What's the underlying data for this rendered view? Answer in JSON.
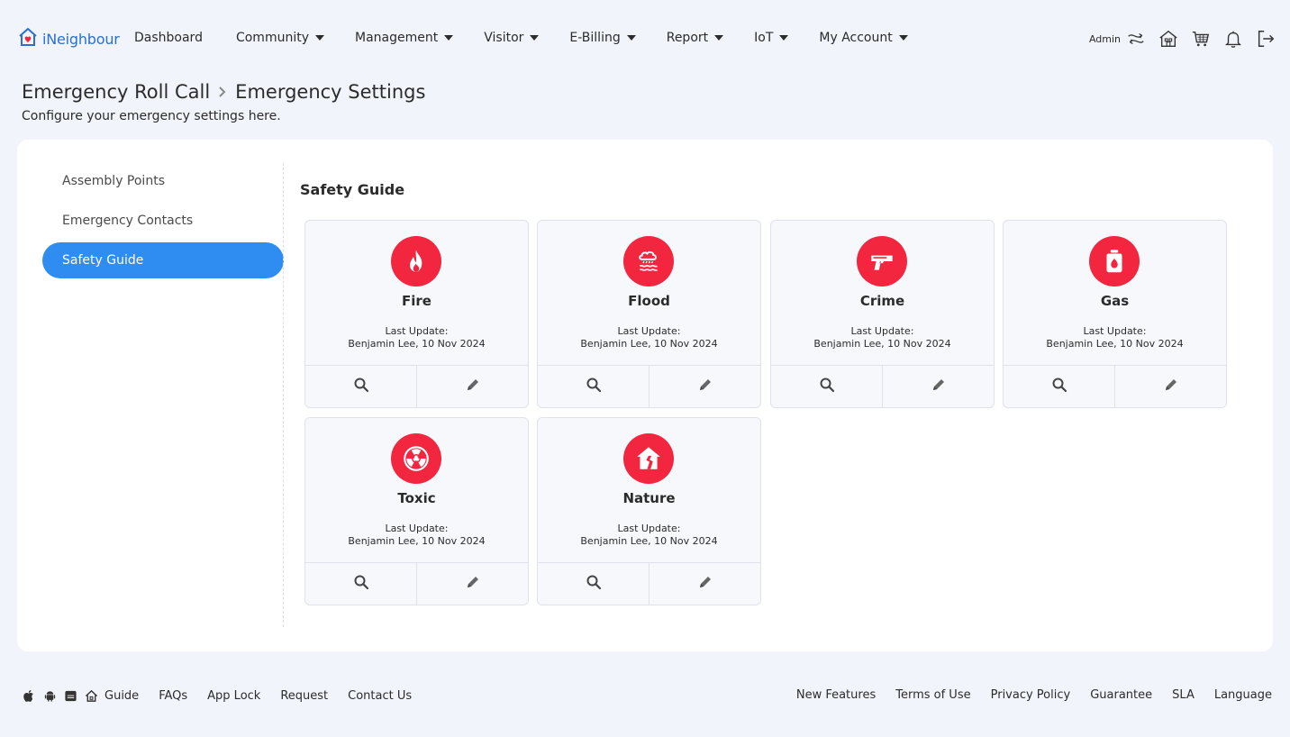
{
  "brand": {
    "name": "iNeighbour",
    "color": "#2a6fd6"
  },
  "nav": {
    "items": [
      {
        "label": "Dashboard",
        "dropdown": false
      },
      {
        "label": "Community",
        "dropdown": true
      },
      {
        "label": "Management",
        "dropdown": true
      },
      {
        "label": "Visitor",
        "dropdown": true
      },
      {
        "label": "E-Billing",
        "dropdown": true
      },
      {
        "label": "Report",
        "dropdown": true
      },
      {
        "label": "IoT",
        "dropdown": true
      },
      {
        "label": "My Account",
        "dropdown": true
      }
    ],
    "user_label": "Admin",
    "right_icons": [
      "switch-icon",
      "property-icon",
      "cart-icon",
      "bell-icon",
      "logout-icon"
    ]
  },
  "header": {
    "breadcrumb_parent": "Emergency Roll Call",
    "breadcrumb_current": "Emergency Settings",
    "subtitle": "Configure your emergency settings here."
  },
  "sidebar": {
    "items": [
      {
        "label": "Assembly Points",
        "active": false
      },
      {
        "label": "Emergency Contacts",
        "active": false
      },
      {
        "label": "Safety Guide",
        "active": true
      }
    ],
    "active_color": "#2f8cf0"
  },
  "section_title": "Safety Guide",
  "accent_red": "#f2263e",
  "guides": [
    {
      "name": "Fire",
      "icon": "fire-icon",
      "last_update_label": "Last Update:",
      "meta": "Benjamin Lee, 10 Nov 2024"
    },
    {
      "name": "Flood",
      "icon": "flood-icon",
      "last_update_label": "Last Update:",
      "meta": "Benjamin Lee, 10 Nov 2024"
    },
    {
      "name": "Crime",
      "icon": "gun-icon",
      "last_update_label": "Last Update:",
      "meta": "Benjamin Lee, 10 Nov 2024"
    },
    {
      "name": "Gas",
      "icon": "gas-cylinder-icon",
      "last_update_label": "Last Update:",
      "meta": "Benjamin Lee, 10 Nov 2024"
    },
    {
      "name": "Toxic",
      "icon": "radiation-icon",
      "last_update_label": "Last Update:",
      "meta": "Benjamin Lee, 10 Nov 2024"
    },
    {
      "name": "Nature",
      "icon": "broken-house-icon",
      "last_update_label": "Last Update:",
      "meta": "Benjamin Lee, 10 Nov 2024"
    }
  ],
  "footer": {
    "left_icons": [
      "apple-icon",
      "android-icon",
      "app-store-icon",
      "home-icon"
    ],
    "left_links": [
      "Guide",
      "FAQs",
      "App Lock",
      "Request",
      "Contact Us"
    ],
    "right_links": [
      "New Features",
      "Terms of Use",
      "Privacy Policy",
      "Guarantee",
      "SLA",
      "Language"
    ]
  }
}
